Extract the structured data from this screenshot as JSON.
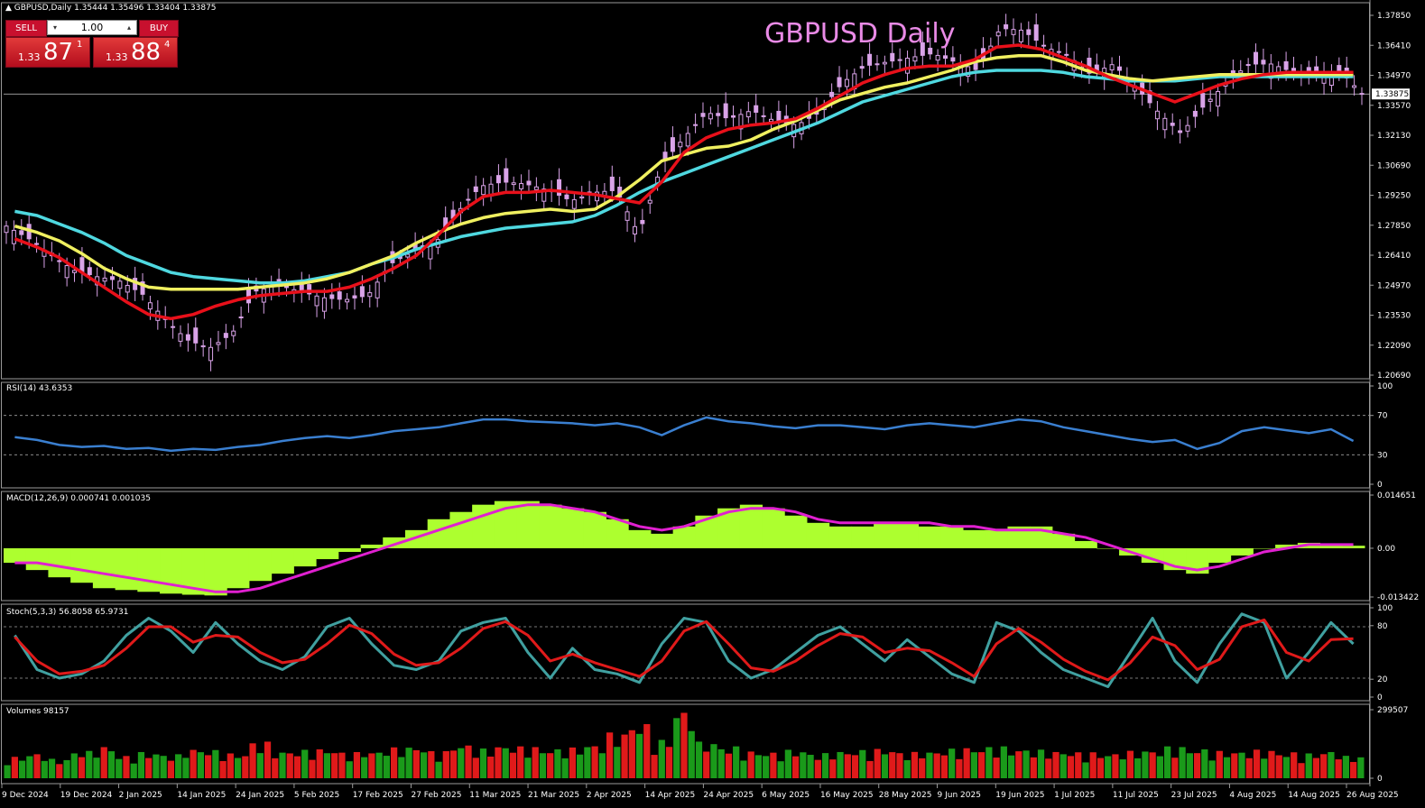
{
  "header": {
    "symbol_info": "▲ GBPUSD,Daily  1.35444 1.35496 1.33404 1.33875",
    "title": "GBPUSD Daily"
  },
  "trade_panel": {
    "sell_label": "SELL",
    "buy_label": "BUY",
    "lot_value": "1.00",
    "sell_price_prefix": "1.33",
    "sell_price_big": "87",
    "sell_price_sup": "1",
    "buy_price_prefix": "1.33",
    "buy_price_big": "88",
    "buy_price_sup": "4"
  },
  "colors": {
    "candle": "#d9a3e8",
    "ema_fast": "#e8101a",
    "ema_mid": "#f0f060",
    "ema_slow": "#4fd8e0",
    "rsi": "#3a7fd0",
    "macd_hist": "#adff2f",
    "macd_signal": "#e020d0",
    "stoch_main": "#40a0a0",
    "stoch_signal": "#e01a1a",
    "vol_up": "#1a9a1a",
    "vol_down": "#e01a1a"
  },
  "chart_data": [
    {
      "type": "candlestick",
      "name": "price",
      "ylim": [
        1.2069,
        1.3787
      ],
      "ytick_labels": [
        "1.37850",
        "1.36410",
        "1.34970",
        "1.33570",
        "1.32130",
        "1.30690",
        "1.29250",
        "1.27850",
        "1.26410",
        "1.24970",
        "1.23530",
        "1.22090",
        "1.20690"
      ],
      "current_price_label": "1.33875",
      "current_price": 1.33875,
      "x_labels": [
        "9 Dec 2024",
        "19 Dec 2024",
        "2 Jan 2025",
        "14 Jan 2025",
        "24 Jan 2025",
        "5 Feb 2025",
        "17 Feb 2025",
        "27 Feb 2025",
        "11 Mar 2025",
        "21 Mar 2025",
        "2 Apr 2025",
        "14 Apr 2025",
        "24 Apr 2025",
        "6 May 2025",
        "16 May 2025",
        "28 May 2025",
        "9 Jun 2025",
        "19 Jun 2025",
        "1 Jul 2025",
        "11 Jul 2025",
        "23 Jul 2025",
        "4 Aug 2025",
        "14 Aug 2025",
        "26 Aug 2025"
      ],
      "close_points": [
        1.276,
        1.27,
        1.262,
        1.255,
        1.252,
        1.25,
        1.244,
        1.232,
        1.222,
        1.218,
        1.225,
        1.245,
        1.248,
        1.245,
        1.242,
        1.241,
        1.243,
        1.258,
        1.264,
        1.268,
        1.283,
        1.295,
        1.297,
        1.296,
        1.293,
        1.288,
        1.292,
        1.293,
        1.272,
        1.305,
        1.318,
        1.33,
        1.327,
        1.331,
        1.326,
        1.324,
        1.33,
        1.344,
        1.352,
        1.354,
        1.356,
        1.358,
        1.354,
        1.35,
        1.37,
        1.369,
        1.361,
        1.357,
        1.348,
        1.353,
        1.342,
        1.33,
        1.32,
        1.333,
        1.344,
        1.353,
        1.353,
        1.349,
        1.348,
        1.35,
        1.339
      ],
      "ema_fast": [
        1.27,
        1.266,
        1.261,
        1.254,
        1.247,
        1.24,
        1.234,
        1.232,
        1.234,
        1.238,
        1.241,
        1.243,
        1.244,
        1.245,
        1.245,
        1.247,
        1.251,
        1.256,
        1.262,
        1.272,
        1.283,
        1.29,
        1.292,
        1.292,
        1.293,
        1.292,
        1.291,
        1.289,
        1.287,
        1.297,
        1.311,
        1.318,
        1.322,
        1.324,
        1.325,
        1.327,
        1.332,
        1.338,
        1.344,
        1.348,
        1.351,
        1.352,
        1.352,
        1.355,
        1.361,
        1.362,
        1.36,
        1.356,
        1.352,
        1.347,
        1.343,
        1.339,
        1.335,
        1.339,
        1.343,
        1.346,
        1.348,
        1.349,
        1.349,
        1.349,
        1.349
      ],
      "ema_mid": [
        1.276,
        1.273,
        1.269,
        1.263,
        1.256,
        1.251,
        1.247,
        1.246,
        1.246,
        1.246,
        1.246,
        1.247,
        1.248,
        1.249,
        1.251,
        1.254,
        1.258,
        1.262,
        1.268,
        1.273,
        1.277,
        1.28,
        1.282,
        1.283,
        1.284,
        1.283,
        1.284,
        1.29,
        1.298,
        1.307,
        1.31,
        1.313,
        1.314,
        1.317,
        1.322,
        1.326,
        1.331,
        1.336,
        1.339,
        1.342,
        1.344,
        1.347,
        1.35,
        1.354,
        1.356,
        1.357,
        1.357,
        1.354,
        1.35,
        1.348,
        1.346,
        1.345,
        1.346,
        1.347,
        1.348,
        1.348,
        1.348,
        1.348,
        1.348,
        1.348,
        1.348
      ],
      "ema_slow": [
        1.283,
        1.281,
        1.277,
        1.273,
        1.268,
        1.262,
        1.258,
        1.254,
        1.252,
        1.251,
        1.25,
        1.249,
        1.249,
        1.25,
        1.252,
        1.254,
        1.258,
        1.261,
        1.265,
        1.268,
        1.271,
        1.273,
        1.275,
        1.276,
        1.277,
        1.278,
        1.281,
        1.286,
        1.292,
        1.297,
        1.301,
        1.305,
        1.309,
        1.313,
        1.317,
        1.321,
        1.325,
        1.33,
        1.335,
        1.338,
        1.341,
        1.344,
        1.347,
        1.349,
        1.35,
        1.35,
        1.35,
        1.349,
        1.347,
        1.346,
        1.345,
        1.345,
        1.345,
        1.346,
        1.347,
        1.347,
        1.347,
        1.347,
        1.347,
        1.347,
        1.347
      ]
    },
    {
      "type": "line",
      "name": "RSI(14) 43.6353",
      "ylim": [
        0,
        100
      ],
      "ytick_labels": [
        "100",
        "70",
        "30",
        "0"
      ],
      "levels": [
        70,
        30
      ],
      "values": [
        48,
        45,
        40,
        38,
        39,
        36,
        37,
        34,
        36,
        35,
        38,
        40,
        44,
        47,
        49,
        47,
        50,
        54,
        56,
        58,
        62,
        66,
        66,
        64,
        63,
        62,
        60,
        62,
        58,
        50,
        60,
        68,
        64,
        62,
        59,
        57,
        60,
        60,
        58,
        56,
        60,
        62,
        60,
        58,
        62,
        66,
        64,
        58,
        54,
        50,
        46,
        43,
        45,
        36,
        42,
        54,
        58,
        55,
        52,
        56,
        44
      ]
    },
    {
      "type": "bar+line",
      "name": "MACD(12,26,9) 0.000741 0.001035",
      "ylim": [
        -0.013422,
        0.014651
      ],
      "ytick_labels": [
        "0.014651",
        "0.00",
        "-0.013422"
      ],
      "histogram": [
        -0.004,
        -0.006,
        -0.008,
        -0.0095,
        -0.011,
        -0.0115,
        -0.012,
        -0.0125,
        -0.0128,
        -0.013,
        -0.011,
        -0.009,
        -0.007,
        -0.005,
        -0.003,
        -0.001,
        0.001,
        0.003,
        0.005,
        0.008,
        0.01,
        0.012,
        0.013,
        0.013,
        0.012,
        0.011,
        0.01,
        0.008,
        0.005,
        0.004,
        0.006,
        0.009,
        0.011,
        0.012,
        0.011,
        0.009,
        0.007,
        0.006,
        0.006,
        0.007,
        0.007,
        0.006,
        0.006,
        0.005,
        0.005,
        0.006,
        0.006,
        0.004,
        0.002,
        0.0,
        -0.002,
        -0.004,
        -0.006,
        -0.007,
        -0.004,
        -0.002,
        0.0,
        0.001,
        0.0015,
        0.001,
        0.0007
      ],
      "signal": [
        -0.004,
        -0.004,
        -0.005,
        -0.006,
        -0.007,
        -0.008,
        -0.009,
        -0.01,
        -0.011,
        -0.012,
        -0.012,
        -0.011,
        -0.009,
        -0.007,
        -0.005,
        -0.003,
        -0.001,
        0.001,
        0.003,
        0.005,
        0.007,
        0.009,
        0.011,
        0.012,
        0.012,
        0.011,
        0.01,
        0.008,
        0.006,
        0.005,
        0.006,
        0.008,
        0.01,
        0.011,
        0.011,
        0.01,
        0.008,
        0.007,
        0.007,
        0.007,
        0.007,
        0.007,
        0.006,
        0.006,
        0.005,
        0.005,
        0.005,
        0.004,
        0.003,
        0.001,
        -0.001,
        -0.003,
        -0.005,
        -0.006,
        -0.005,
        -0.003,
        -0.001,
        0.0,
        0.001,
        0.001,
        0.001
      ]
    },
    {
      "type": "line",
      "name": "Stoch(5,3,3) 56.8058 65.9731",
      "ylim": [
        0,
        100
      ],
      "ytick_labels": [
        "100",
        "80",
        "20",
        "0"
      ],
      "levels": [
        80,
        20
      ],
      "main": [
        70,
        30,
        20,
        25,
        40,
        70,
        90,
        75,
        50,
        85,
        60,
        40,
        30,
        45,
        80,
        90,
        60,
        35,
        30,
        40,
        75,
        85,
        90,
        50,
        20,
        55,
        30,
        25,
        15,
        60,
        90,
        85,
        40,
        20,
        30,
        50,
        70,
        80,
        60,
        40,
        65,
        45,
        25,
        15,
        85,
        75,
        50,
        30,
        20,
        10,
        50,
        90,
        40,
        15,
        60,
        95,
        85,
        20,
        50,
        85,
        60
      ],
      "signal": [
        68,
        40,
        25,
        28,
        35,
        55,
        80,
        80,
        62,
        70,
        68,
        50,
        38,
        42,
        60,
        82,
        72,
        48,
        35,
        38,
        55,
        78,
        86,
        70,
        40,
        48,
        38,
        30,
        22,
        40,
        75,
        86,
        60,
        32,
        28,
        40,
        58,
        72,
        68,
        50,
        55,
        52,
        38,
        22,
        60,
        78,
        62,
        42,
        28,
        18,
        38,
        68,
        58,
        30,
        42,
        80,
        88,
        50,
        40,
        65,
        66
      ]
    },
    {
      "type": "bar",
      "name": "Volumes 98157",
      "ylim": [
        0,
        299507
      ],
      "ytick_labels": [
        "299507",
        "0"
      ],
      "values": [
        95000,
        110000,
        85000,
        120000,
        140000,
        100000,
        115000,
        105000,
        130000,
        125000,
        110000,
        160000,
        120000,
        125000,
        130000,
        115000,
        120000,
        135000,
        140000,
        120000,
        150000,
        130000,
        145000,
        140000,
        130000,
        135000,
        150000,
        200000,
        240000,
        170000,
        300000,
        160000,
        140000,
        120000,
        115000,
        125000,
        110000,
        120000,
        125000,
        130000,
        115000,
        120000,
        130000,
        135000,
        140000,
        130000,
        125000,
        120000,
        115000,
        110000,
        120000,
        125000,
        140000,
        130000,
        120000,
        120000,
        125000,
        115000,
        110000,
        120000,
        98000
      ],
      "up": [
        1,
        0,
        1,
        0,
        1,
        0,
        1,
        0,
        1,
        1,
        0,
        1,
        0,
        1,
        0,
        1,
        1,
        0,
        1,
        1,
        0,
        1,
        0,
        1,
        1,
        0,
        1,
        1,
        0,
        1,
        1,
        0,
        1,
        0,
        1,
        0,
        1,
        1,
        0,
        1,
        0,
        1,
        0,
        1,
        1,
        0,
        0,
        1,
        0,
        1,
        1,
        0,
        1,
        0,
        1,
        1,
        0,
        1,
        0,
        1,
        1
      ]
    }
  ]
}
